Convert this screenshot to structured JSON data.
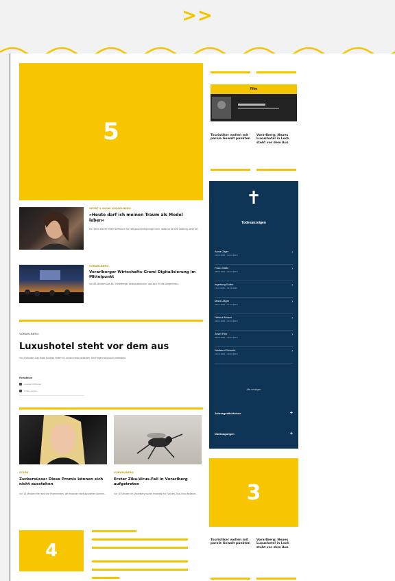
{
  "nav": {
    "arrows": ">>"
  },
  "ads": {
    "ad5": "5",
    "ad3": "3",
    "ad4": "4"
  },
  "articles": [
    {
      "kicker": "Sport & Show Vorarlberg",
      "headline": "»Heute darf ich meinen Traum als Model leben«",
      "teaser": "Ihr Leben könnte einem Drehbuch für Hollywood entsprungen sein, dabei ist sie erst zwanzig Jahre alt."
    },
    {
      "kicker": "Vorarlberg",
      "headline": "Vorarlberger Wirtschafts-Gremi Digitalisierung im Mittelpunkt",
      "teaser": "Vor 55 Minuten Das 55. Vorarlberger Wirtschaftsforum, das sich für die Bürgerinnen..."
    }
  ],
  "lead": {
    "kicker": "Vorarlberg",
    "headline": "Luxushotel steht vor dem aus",
    "teaser": "Vor 2 Minuten Das Hotel Schloss Hofen in Lochau muss schließen. Die Folgen sind noch unbekannt.",
    "author": "Redaktion",
    "meta1": "Lesezeit 3 Minuten",
    "meta2": "Artikel merken"
  },
  "grid_articles": [
    {
      "kicker": "Stars",
      "headline": "Zuckersüsse: Diese Promis können sich nicht ausstehen",
      "teaser": "Vor 15 Minuten Hier sind die Prominenten, die einander nicht ausstehen können..."
    },
    {
      "kicker": "Vorarlberg",
      "headline": "Erster Zika-Virus-Fall in Vorarlberg aufgetreten",
      "teaser": "Vor 10 Minuten Im Vorarlberg wurde erstmals ein Fall des Zika-Virus bekannt..."
    }
  ],
  "sidebar": {
    "promo_title": "Film",
    "teaser_left": "Touristiker wollen mit parole Gewalt punkten",
    "teaser_right": "Vorarlberg: Neues Luxushotel in Lech steht vor dem Aus",
    "teaser_left_b": "Touristiker wollen mit parole Gewalt punkten",
    "teaser_right_b": "Vorarlberg: Neues Luxushotel in Lech steht vor dem Aus",
    "obituaries": {
      "cross": "✝",
      "title": "Todesanzeigen",
      "entries": [
        {
          "name": "Anna Giger",
          "date": "12.02.1938 – 03.10.2019"
        },
        {
          "name": "Franz Mähr",
          "date": "08.05.1941 – 02.10.2019"
        },
        {
          "name": "Ingeborg Sutter",
          "date": "17.11.1929 – 02.10.2019"
        },
        {
          "name": "Maria Jäger",
          "date": "03.07.1935 – 01.10.2019"
        },
        {
          "name": "Helmut Moser",
          "date": "22.01.1948 – 01.10.2019"
        },
        {
          "name": "Josef Fink",
          "date": "09.09.1930 – 30.09.2019"
        },
        {
          "name": "Waltraud Schmid",
          "date": "14.04.1944 – 30.09.2019"
        }
      ],
      "more": "Alle anzeigen",
      "links": [
        "Jahresgedächtnisse",
        "Danksagungen"
      ]
    }
  }
}
